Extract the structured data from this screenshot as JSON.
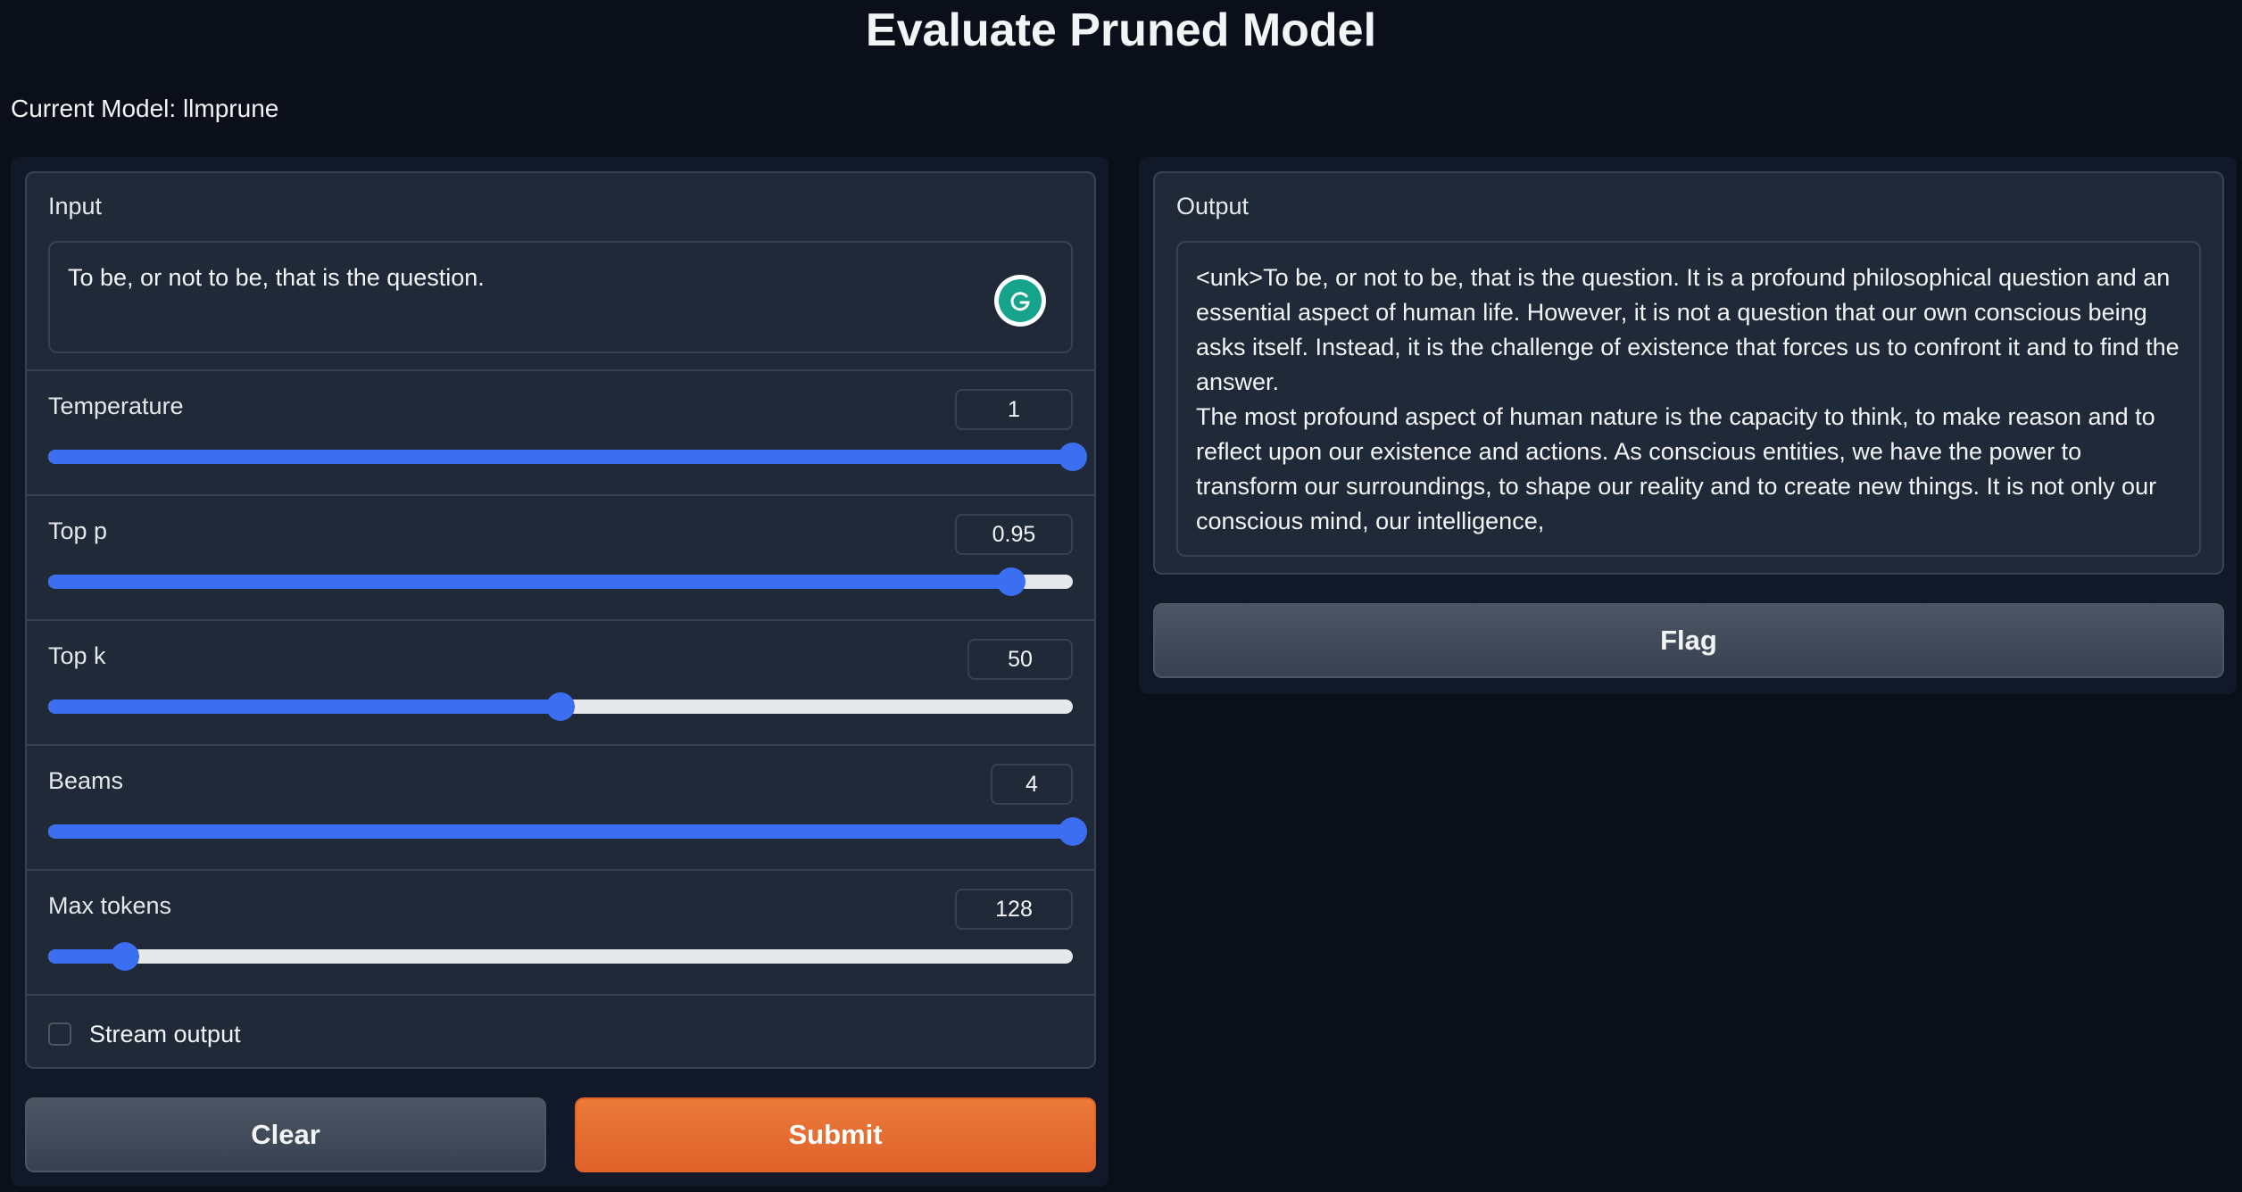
{
  "page": {
    "title": "Evaluate Pruned Model",
    "current_model": "Current Model: llmprune"
  },
  "input": {
    "label": "Input",
    "value": "To be, or not to be, that is the question.",
    "extension_icon": "grammarly-icon"
  },
  "sliders": {
    "temperature": {
      "label": "Temperature",
      "value": "1",
      "fraction": 1.0
    },
    "top_p": {
      "label": "Top p",
      "value": "0.95",
      "fraction": 0.94
    },
    "top_k": {
      "label": "Top k",
      "value": "50",
      "fraction": 0.5
    },
    "beams": {
      "label": "Beams",
      "value": "4",
      "fraction": 1.0
    },
    "max_tokens": {
      "label": "Max tokens",
      "value": "128",
      "fraction": 0.075
    }
  },
  "stream": {
    "label": "Stream output",
    "checked": false
  },
  "buttons": {
    "clear": "Clear",
    "submit": "Submit",
    "flag": "Flag"
  },
  "output": {
    "label": "Output",
    "paragraph1": "<unk>To be, or not to be, that is the question. It is a profound philosophical question and an essential aspect of human life. However, it is not a question that our own conscious being asks itself. Instead, it is the challenge of existence that forces us to confront it and to find the answer.",
    "paragraph2": "The most profound aspect of human nature is the capacity to think, to make reason and to reflect upon our existence and actions. As conscious entities, we have the power to transform our surroundings, to shape our reality and to create new things. It is not only our conscious mind, our intelligence,"
  },
  "colors": {
    "accent": "#3b6ef0",
    "submit": "#e8702f",
    "background": "#0b0f19",
    "panel": "#1f2937"
  }
}
